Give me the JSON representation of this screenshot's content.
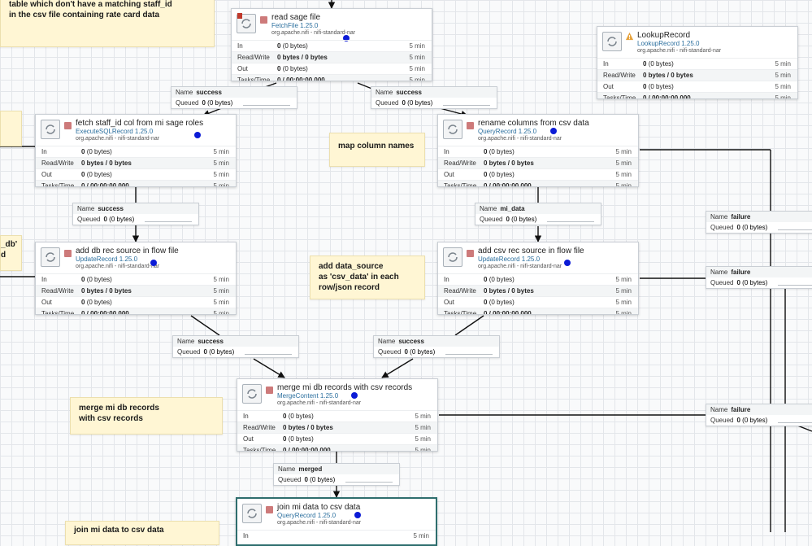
{
  "processors": {
    "read_sage_file": {
      "name": "read sage file",
      "type": "FetchFile 1.25.0",
      "bundle": "org.apache.nifi - nifi-standard-nar"
    },
    "lookup_record": {
      "name": "LookupRecord",
      "type": "LookupRecord 1.25.0",
      "bundle": "org.apache.nifi - nifi-standard-nar"
    },
    "fetch_staff_id": {
      "name": "fetch staff_id col from mi sage roles",
      "type": "ExecuteSQLRecord 1.25.0",
      "bundle": "org.apache.nifi - nifi-standard-nar"
    },
    "rename_columns": {
      "name": "rename columns from csv data",
      "type": "QueryRecord 1.25.0",
      "bundle": "org.apache.nifi - nifi-standard-nar"
    },
    "add_db_source": {
      "name": "add db rec source in flow file",
      "type": "UpdateRecord 1.25.0",
      "bundle": "org.apache.nifi - nifi-standard-nar"
    },
    "add_csv_source": {
      "name": "add csv rec source in flow file",
      "type": "UpdateRecord 1.25.0",
      "bundle": "org.apache.nifi - nifi-standard-nar"
    },
    "merge_records": {
      "name": "merge mi db records with csv records",
      "type": "MergeContent 1.25.0",
      "bundle": "org.apache.nifi - nifi-standard-nar"
    },
    "join_mi_data": {
      "name": "join mi data to csv data",
      "type": "QueryRecord 1.25.0",
      "bundle": "org.apache.nifi - nifi-standard-nar",
      "stat_in_label": "In"
    }
  },
  "stats": {
    "in_label": "In",
    "rw_label": "Read/Write",
    "out_label": "Out",
    "tasks_label": "Tasks/Time",
    "in_count": "0",
    "in_bytes": "(0 bytes)",
    "rw_value": "0 bytes / 0 bytes",
    "out_count": "0",
    "out_bytes": "(0 bytes)",
    "tasks_value": "0 / 00:00:00.000",
    "window": "5 min"
  },
  "connections": {
    "name_key": "Name",
    "queued_key": "Queued",
    "queued_count": "0",
    "queued_bytes": "(0 bytes)",
    "success": "success",
    "mi_data": "mi_data",
    "failure": "failure",
    "merged": "merged"
  },
  "labels": {
    "top_left": "table which don't have a matching staff_id\nin the csv file containing rate card data",
    "map_columns": "map column names",
    "add_data_source": "add data_source\nas 'csv_data' in each\nrow/json record",
    "merge_label": "merge mi db records\nwith csv records",
    "join_label": "join mi data to csv data",
    "left_partial": "_db'\nd"
  }
}
